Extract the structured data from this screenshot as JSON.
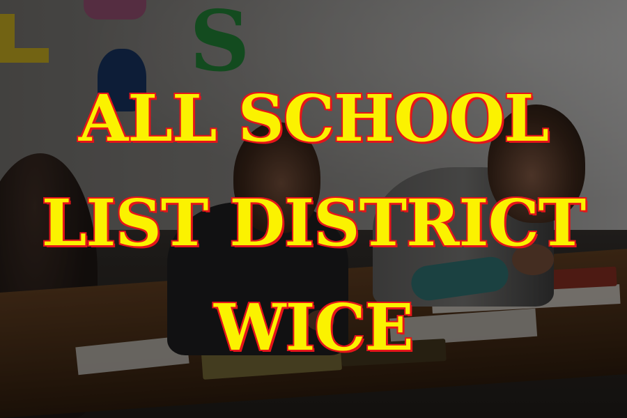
{
  "image": {
    "headline_lines": [
      "ALL SCHOOL",
      "LIST DISTRICT",
      "WICE"
    ],
    "text_fill_color": "#fbf200",
    "text_outline_color": "#e4161b",
    "wall_letter": "S"
  }
}
